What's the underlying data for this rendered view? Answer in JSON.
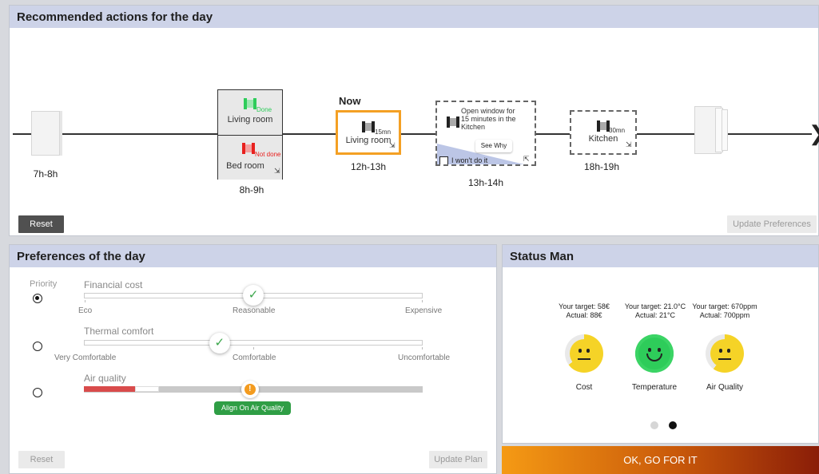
{
  "recommended": {
    "title": "Recommended actions for the day",
    "slots": {
      "s1": {
        "time": "7h-8h"
      },
      "s2": {
        "time": "8h-9h",
        "top_room": "Living room",
        "top_status": "Done",
        "bottom_room": "Bed room",
        "bottom_status": "Not done"
      },
      "s3": {
        "now": "Now",
        "room": "Living room",
        "duration": "15mn",
        "time": "12h-13h"
      },
      "s4": {
        "text": "Open window for 15 minutes in the Kitchen",
        "see_why": "See Why",
        "wont_do": "I won't do it",
        "time": "13h-14h"
      },
      "s5": {
        "room": "Kitchen",
        "duration": "30mn",
        "time": "18h-19h"
      }
    },
    "reset_label": "Reset",
    "update_label": "Update Preferences"
  },
  "preferences": {
    "title": "Preferences of the day",
    "priority_label": "Priority",
    "selected_priority": 0,
    "financial": {
      "title": "Financial cost",
      "low": "Eco",
      "mid": "Reasonable",
      "high": "Expensive",
      "value": 0.5
    },
    "thermal": {
      "title": "Thermal comfort",
      "low": "Very Comfortable",
      "mid": "Comfortable",
      "high": "Uncomfortable",
      "value": 0.4
    },
    "air": {
      "title": "Air quality",
      "value": 0.49
    },
    "align_label": "Align On Air Quality",
    "reset_label": "Reset",
    "update_label": "Update Plan"
  },
  "status": {
    "title": "Status Man",
    "cost": {
      "target": "Your target: 58€",
      "actual": "Actual: 88€",
      "label": "Cost",
      "color": "#f5d327"
    },
    "temperature": {
      "target": "Your target: 21.0°C",
      "actual": "Actual: 21°C",
      "label": "Temperature",
      "color": "#2ecc5a"
    },
    "air": {
      "target": "Your target: 670ppm",
      "actual": "Actual: 700ppm",
      "label": "Air Quality",
      "color": "#f5d327"
    },
    "active_page": 2,
    "page_count": 2
  },
  "go_label": "OK, GO FOR IT",
  "colors": {
    "done": "#2ecc5a",
    "not_done": "#e8211f",
    "now_border": "#f4a024",
    "air_bad": "#d94b4b",
    "air_mid": "#c9c9c9"
  }
}
